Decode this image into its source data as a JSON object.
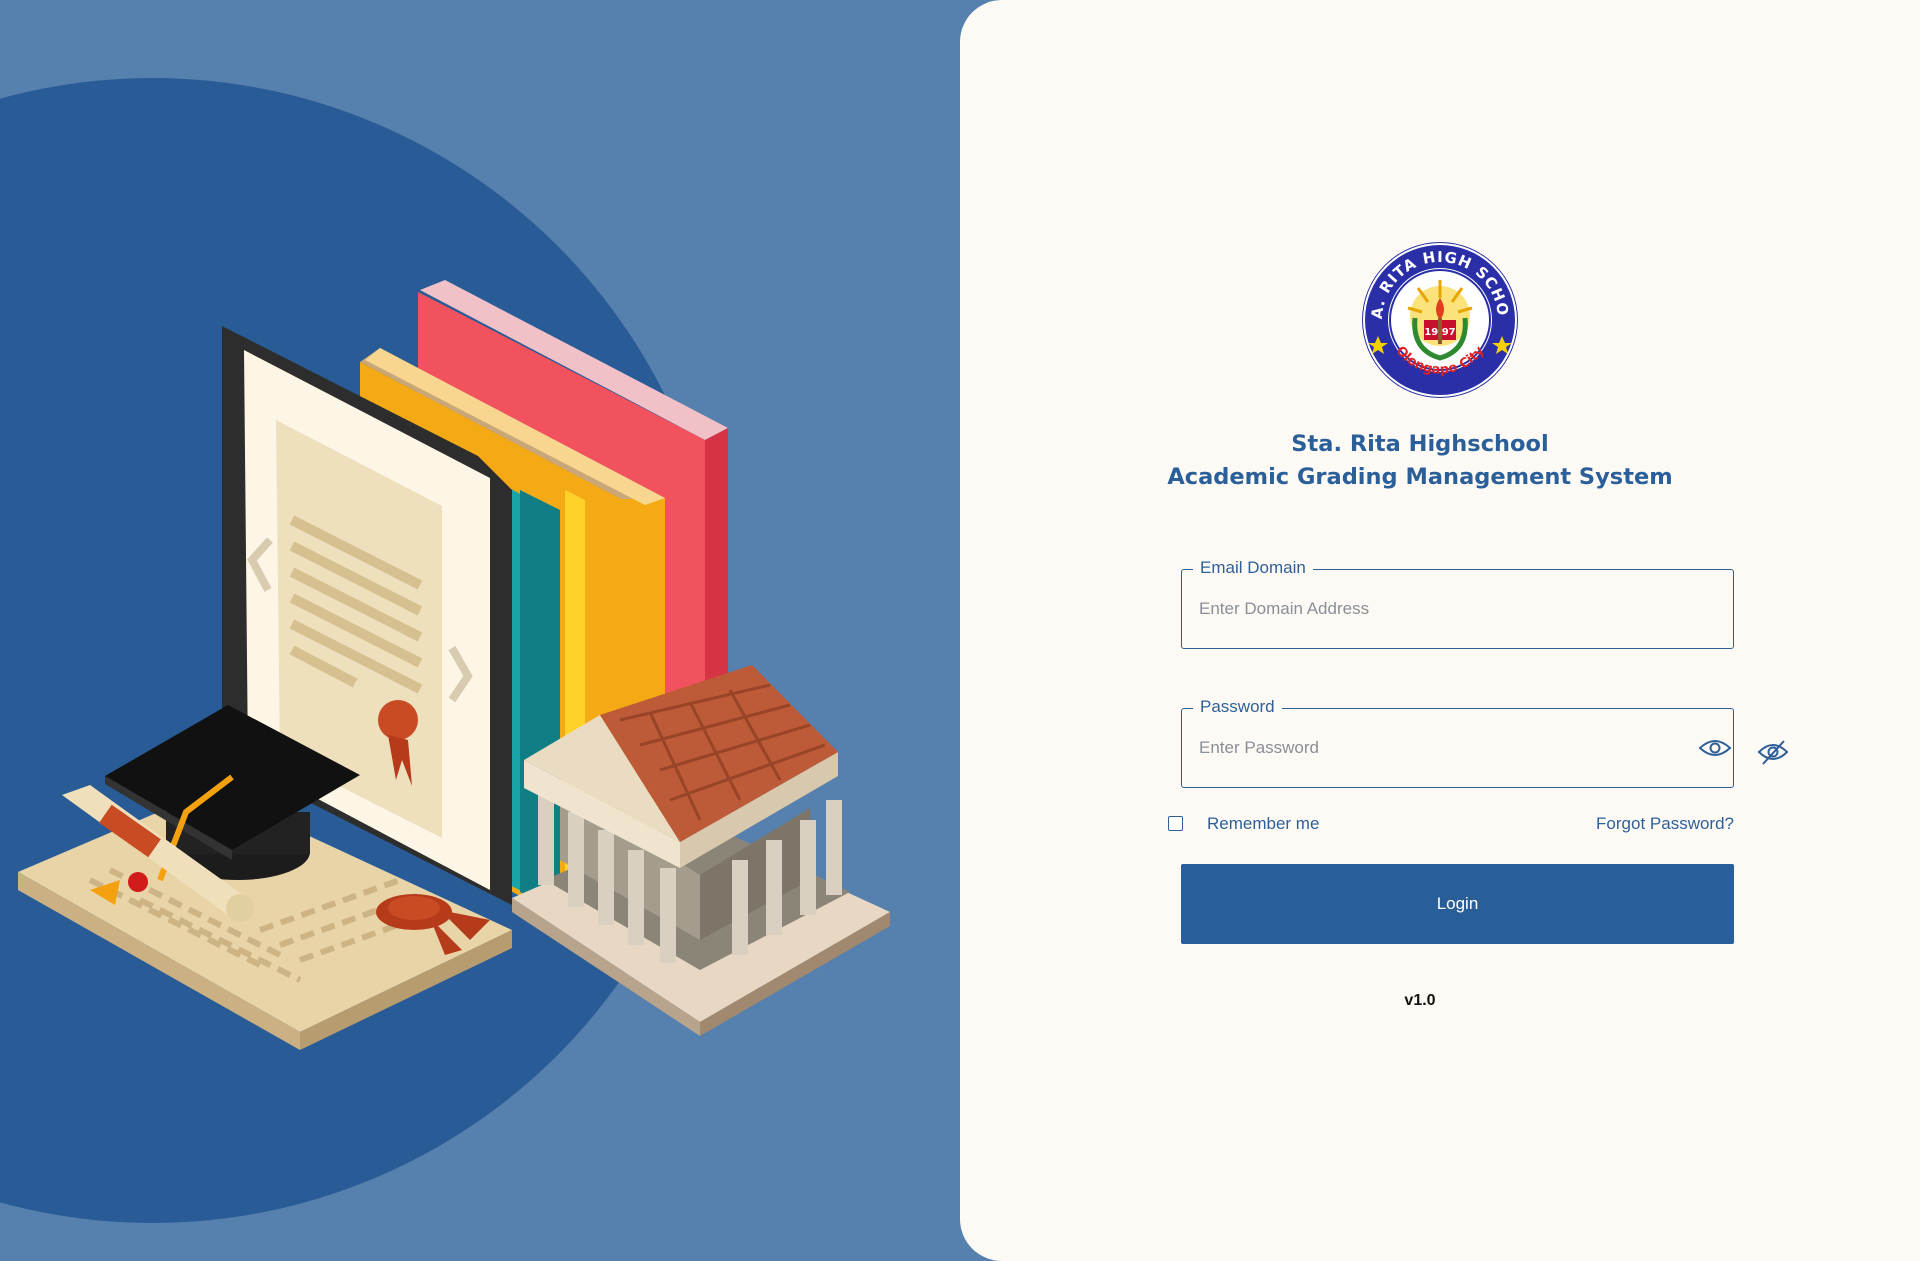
{
  "school": {
    "logo_alt": "school-logo",
    "logo_ring_text": "STA. RITA HIGH SCHOOL",
    "logo_bottom_text": "Olongapo City",
    "logo_year": "19 97",
    "name": "Sta. Rita Highschool",
    "system_name": "Academic Grading Management System"
  },
  "form": {
    "email": {
      "label": "Email Domain",
      "placeholder": "Enter Domain Address",
      "value": ""
    },
    "password": {
      "label": "Password",
      "placeholder": "Enter Password",
      "value": ""
    },
    "remember_label": "Remember me",
    "forgot_label": "Forgot Password?",
    "login_label": "Login"
  },
  "version": "v1.0",
  "colors": {
    "brand_blue": "#2a5e98",
    "background_light_blue": "#5680ad",
    "circle_blue": "#295c96",
    "panel_bg": "#fdfaf6"
  },
  "icons": [
    "eye-icon",
    "eye-off-icon",
    "school-logo"
  ]
}
